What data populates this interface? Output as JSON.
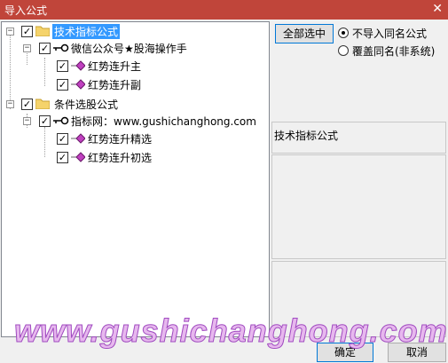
{
  "window": {
    "title": "导入公式",
    "close_glyph": "✕"
  },
  "tree": {
    "groups": [
      {
        "label": "技术指标公式",
        "checked": true,
        "expanded": true,
        "selected": true,
        "children": [
          {
            "label": "微信公众号★股海操作手",
            "checked": true,
            "expanded": true,
            "items": [
              {
                "label": "红势连升主",
                "checked": true
              },
              {
                "label": "红势连升副",
                "checked": true
              }
            ]
          }
        ]
      },
      {
        "label": "条件选股公式",
        "checked": true,
        "expanded": true,
        "selected": false,
        "children": [
          {
            "label": "指标网：www.gushichanghong.com",
            "checked": true,
            "expanded": true,
            "items": [
              {
                "label": "红势连升精选",
                "checked": true
              },
              {
                "label": "红势连升初选",
                "checked": true
              }
            ]
          }
        ]
      }
    ]
  },
  "options": {
    "select_all_label": "全部选中",
    "radio_no_import_same": "不导入同名公式",
    "radio_overwrite_same": "覆盖同名(非系统)",
    "selected_radio": "no_import_same"
  },
  "preview": {
    "title": "技术指标公式"
  },
  "buttons": {
    "ok_label": "确定",
    "cancel_label": "取消"
  },
  "watermark": {
    "text": "www.gushichanghong.com"
  },
  "colors": {
    "titlebar": "#c0453a",
    "selection": "#3399ff",
    "watermark": "#e7b8ee"
  }
}
